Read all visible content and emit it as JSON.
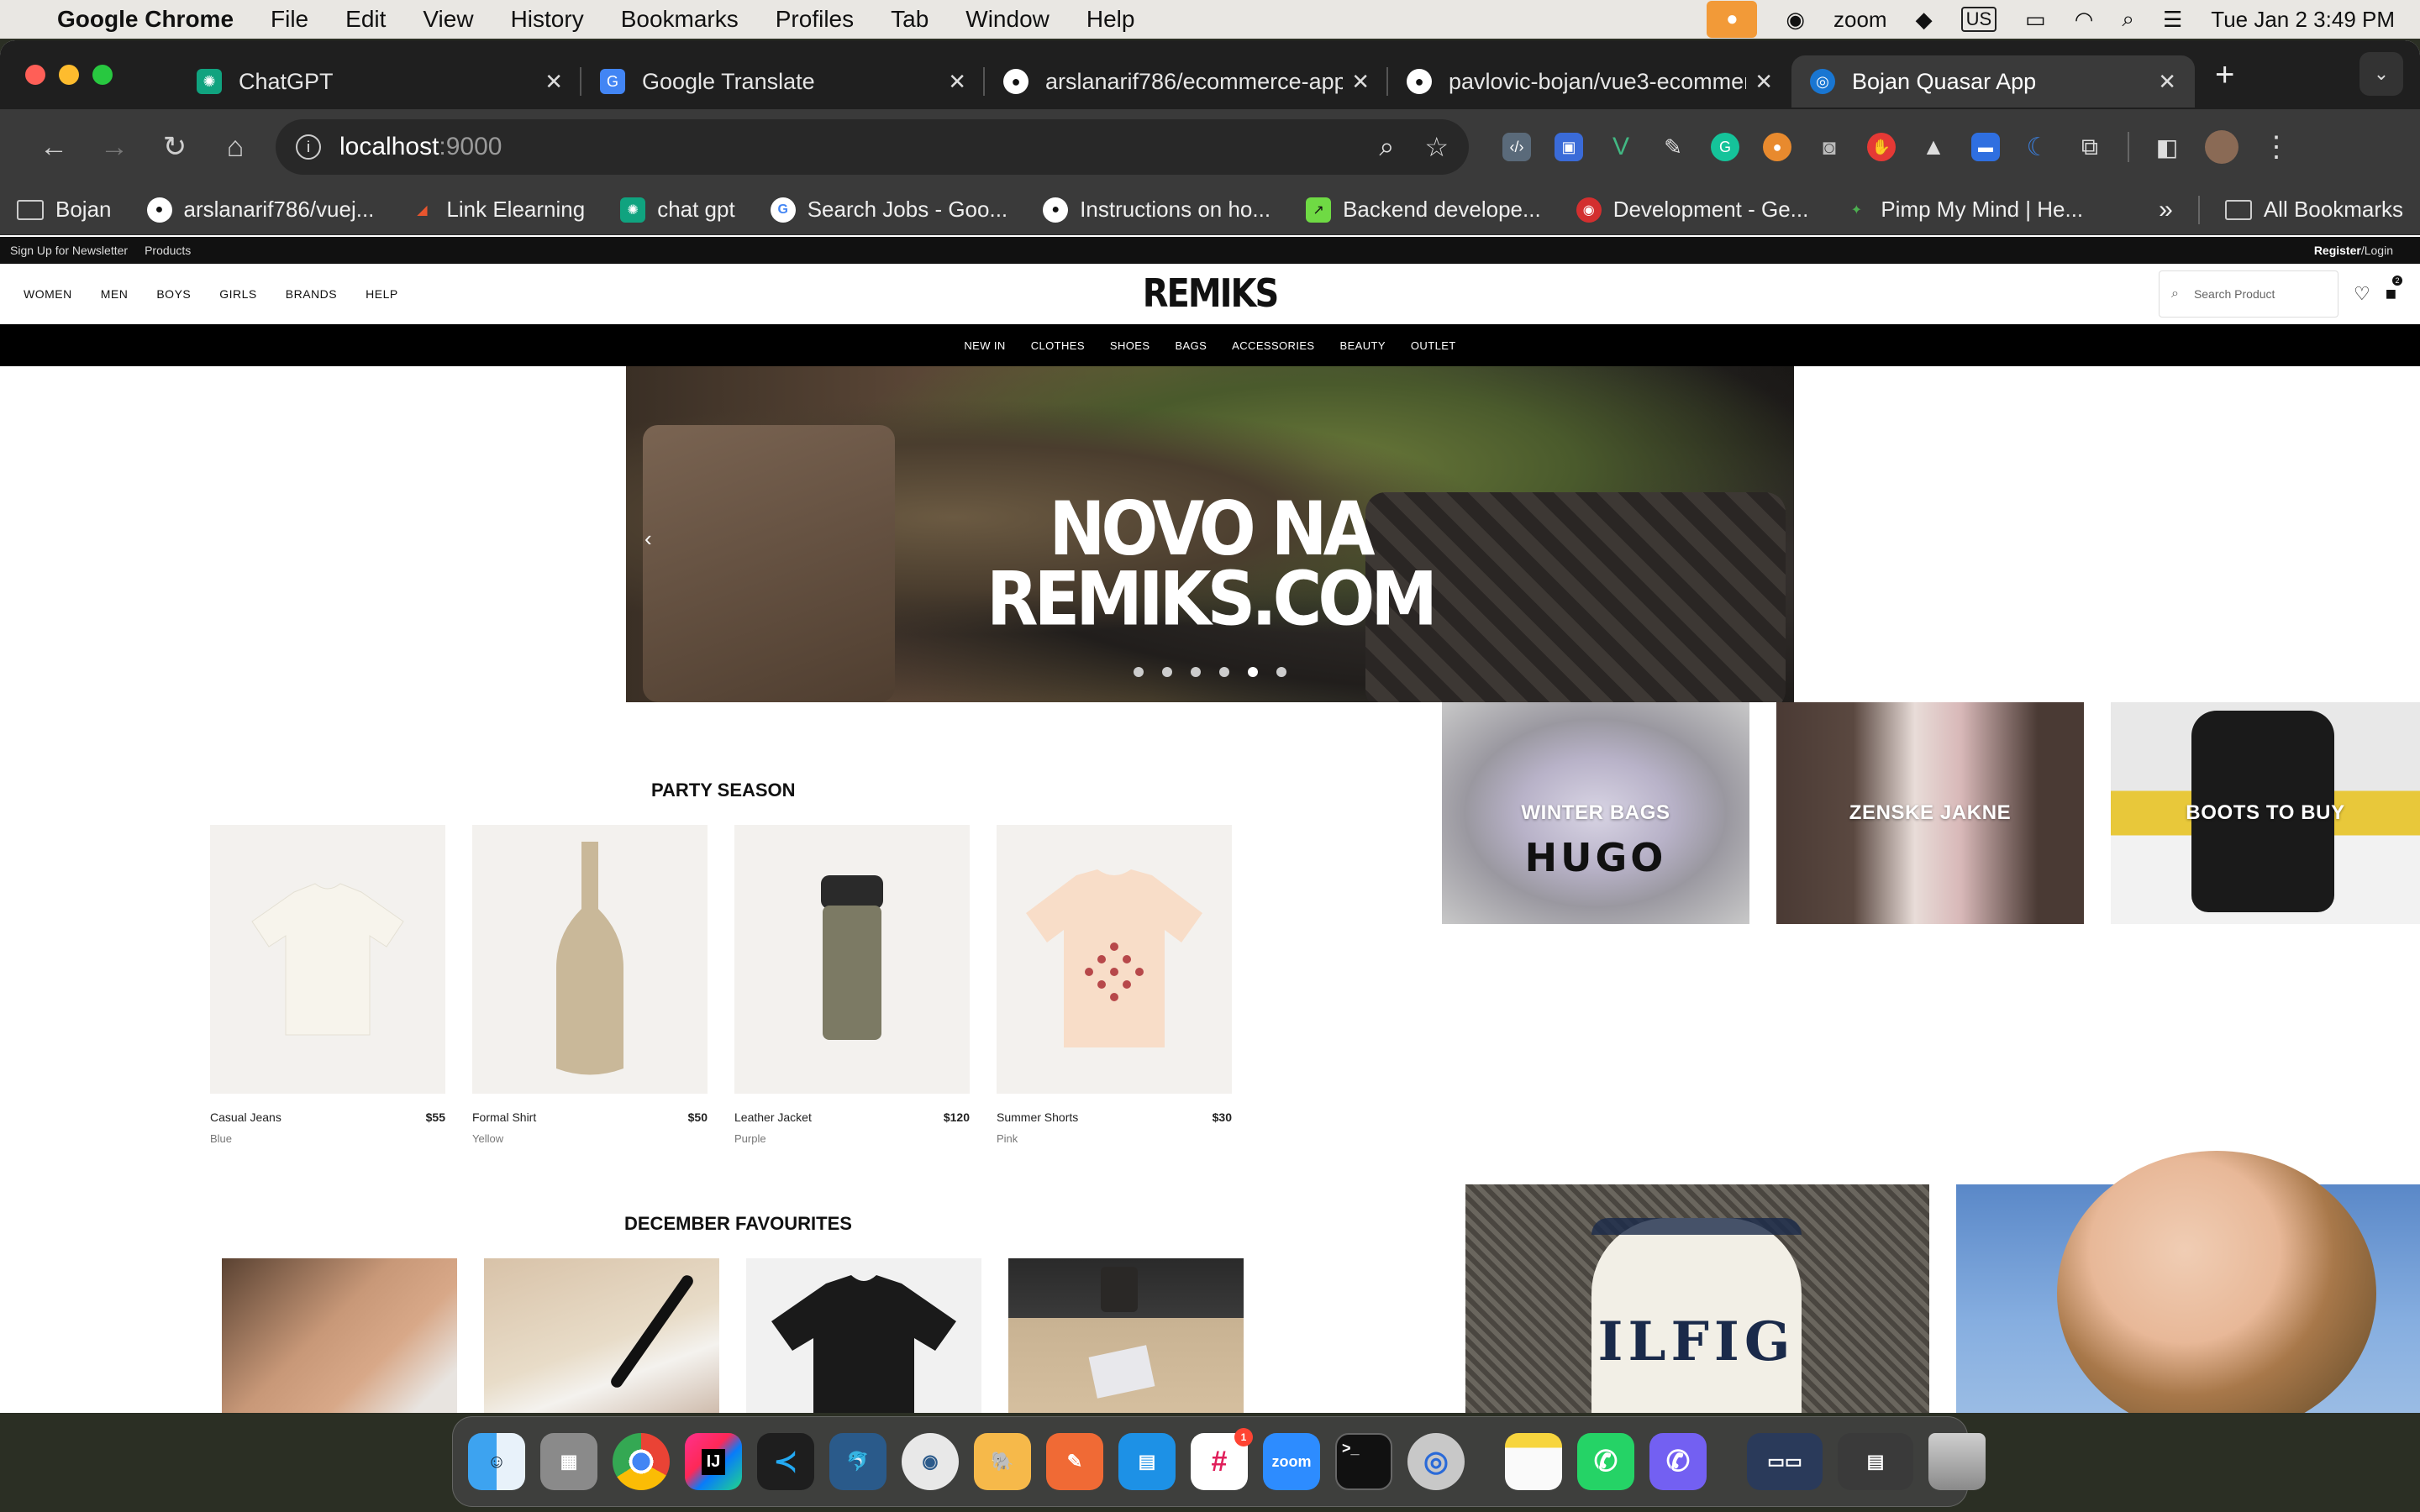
{
  "menubar": {
    "app": "Google Chrome",
    "items": [
      "File",
      "Edit",
      "View",
      "History",
      "Bookmarks",
      "Profiles",
      "Tab",
      "Window",
      "Help"
    ],
    "zoom": "zoom",
    "keyboard": "US",
    "clock": "Tue Jan 2  3:49 PM"
  },
  "tabs": [
    {
      "title": "ChatGPT",
      "icon": "chatgpt-icon",
      "color": "#10a37f"
    },
    {
      "title": "Google Translate",
      "icon": "google-translate-icon",
      "color": "#4285f4"
    },
    {
      "title": "arslanarif786/ecommerce-app",
      "icon": "github-icon",
      "color": "#333333"
    },
    {
      "title": "pavlovic-bojan/vue3-ecommerce",
      "icon": "github-icon",
      "color": "#333333"
    },
    {
      "title": "Bojan Quasar App",
      "icon": "quasar-icon",
      "color": "#1976d2"
    }
  ],
  "toolbar": {
    "url_host": "localhost",
    "url_port": ":9000"
  },
  "bookmarks": [
    {
      "label": "Bojan",
      "icon": "folder-icon"
    },
    {
      "label": "arslanarif786/vuej...",
      "icon": "github-icon"
    },
    {
      "label": "Link Elearning",
      "icon": "link-elearning-icon"
    },
    {
      "label": "chat gpt",
      "icon": "chatgpt-icon"
    },
    {
      "label": "Search Jobs - Goo...",
      "icon": "google-icon"
    },
    {
      "label": "Instructions on ho...",
      "icon": "github-icon"
    },
    {
      "label": "Backend develope...",
      "icon": "upwork-icon"
    },
    {
      "label": "Development - Ge...",
      "icon": "development-icon"
    },
    {
      "label": "Pimp My Mind | He...",
      "icon": "pimp-my-mind-icon"
    }
  ],
  "bookmarks_more": "»",
  "all_bookmarks": "All Bookmarks",
  "site": {
    "topstrip": {
      "newsletter": "Sign Up for Newsletter",
      "products": "Products",
      "register": "Register",
      "login": "/Login"
    },
    "categories": [
      "WOMEN",
      "MEN",
      "BOYS",
      "GIRLS",
      "BRANDS",
      "HELP"
    ],
    "logo": "REMIKS",
    "search_placeholder": "Search Product",
    "cart_count": "2",
    "subnav": [
      "NEW IN",
      "CLOTHES",
      "SHOES",
      "BAGS",
      "ACCESSORIES",
      "BEAUTY",
      "OUTLET"
    ],
    "hero": {
      "line1": "NOVO NA",
      "line2": "REMIKS.COM",
      "slides": 6,
      "active_slide": 5
    },
    "promos": [
      {
        "label": "WINTER BAGS",
        "brand": "HUGO"
      },
      {
        "label": "ZENSKE JAKNE"
      },
      {
        "label": "BOOTS TO BUY"
      }
    ],
    "party_title": "PARTY SEASON",
    "party_products": [
      {
        "name": "Casual Jeans",
        "price": "$55",
        "color": "Blue"
      },
      {
        "name": "Formal Shirt",
        "price": "$50",
        "color": "Yellow"
      },
      {
        "name": "Leather Jacket",
        "price": "$120",
        "color": "Purple"
      },
      {
        "name": "Summer Shorts",
        "price": "$30",
        "color": "Pink"
      }
    ],
    "december_title": "DECEMBER FAVOURITES",
    "editorial_text": "ILFIG"
  },
  "dock_apps": [
    "Finder",
    "Launchpad",
    "Chrome",
    "IntelliJ IDEA",
    "VS Code",
    "MySQL Workbench",
    "Sourcetree",
    "TablePlus",
    "Postman",
    "Docker",
    "Slack",
    "Zoom",
    "Terminal",
    "QuickTime",
    "Notes",
    "WhatsApp",
    "Viber",
    "Window Overview",
    "Trash"
  ],
  "dock_labels": {
    "intellij": "IJ",
    "zoom": "zoom",
    "terminal": ">_",
    "slack_badge": "1"
  }
}
